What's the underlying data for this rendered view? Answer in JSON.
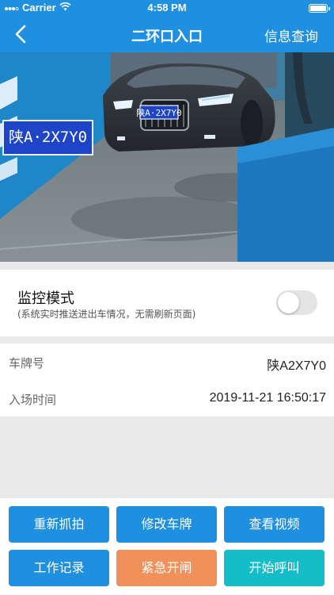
{
  "status_bar": {
    "carrier": "Carrier",
    "time": "4:58 PM"
  },
  "nav": {
    "title": "二环口入口",
    "action_label": "信息查询",
    "back_icon": "chevron-left-icon"
  },
  "camera": {
    "plate_overlay": "陕A·2X7Y0",
    "car_plate_text": "陕A·2X7Y0"
  },
  "monitor_mode": {
    "label": "监控模式",
    "hint": "(系统实时推送进出车情况，无需刷新页面)",
    "enabled": false
  },
  "vehicle_info": {
    "plate_label": "车牌号",
    "plate_value": "陕A2X7Y0",
    "entry_time_label": "入场时间",
    "entry_time_value": "2019-11-21 16:50:17"
  },
  "buttons": {
    "recapture": "重新抓拍",
    "edit_plate": "修改车牌",
    "view_video": "查看视频",
    "work_log": "工作记录",
    "emergency_open": "紧急开闸",
    "start_call": "开始呼叫"
  },
  "colors": {
    "primary": "#1f90e0",
    "warning": "#f0905a",
    "teal": "#14bdc8"
  }
}
